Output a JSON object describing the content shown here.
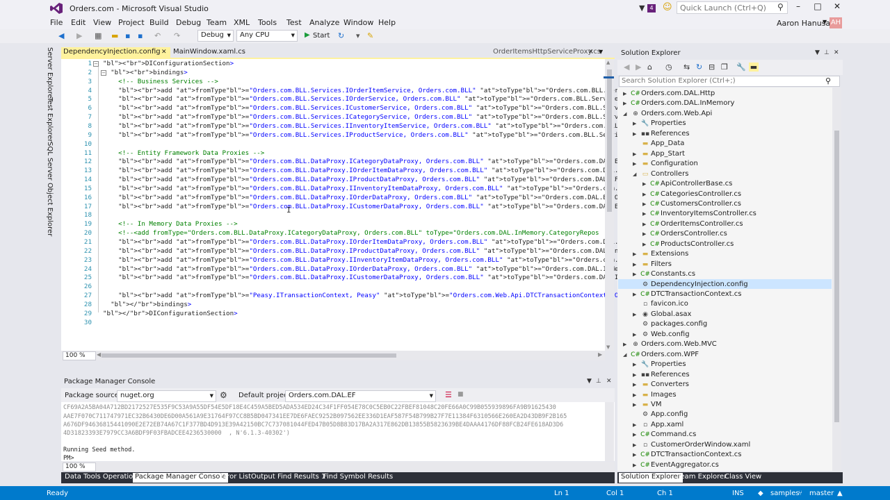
{
  "window": {
    "title": "Orders.com - Microsoft Visual Studio",
    "notification_count": "4",
    "quick_launch_placeholder": "Quick Launch (Ctrl+Q)",
    "controls": [
      "–",
      "□",
      "✕"
    ]
  },
  "menu": [
    "File",
    "Edit",
    "View",
    "Project",
    "Build",
    "Debug",
    "Team",
    "XML",
    "Tools",
    "Test",
    "Analyze",
    "Window",
    "Help"
  ],
  "user": {
    "name": "Aaron Hanusa",
    "initials": "AH"
  },
  "toolbar": {
    "config": "Debug",
    "platform": "Any CPU",
    "start_label": "Start"
  },
  "side_tabs": [
    "Server Explorer",
    "Test Explorer",
    "SQL Server Object Explorer"
  ],
  "editor": {
    "tabs": [
      "DependencyInjection.config",
      "MainWindow.xaml.cs",
      "OrderItemsHttpServiceProxy.cs"
    ],
    "zoom": "100 %",
    "line_numbers": [
      "1",
      "2",
      "3",
      "4",
      "5",
      "6",
      "7",
      "8",
      "9",
      "10",
      "11",
      "12",
      "13",
      "14",
      "15",
      "16",
      "17",
      "18",
      "19",
      "20",
      "21",
      "22",
      "23",
      "24",
      "25",
      "26",
      "27",
      "28",
      "29",
      "30"
    ],
    "lines": [
      "<DIConfigurationSection>",
      "  <bindings>",
      "    <!-- Business Services -->",
      "    <add fromType=\"Orders.com.BLL.Services.IOrderItemService, Orders.com.BLL\" toType=\"Orders.com.BLL.Services.OrderItemService, O",
      "    <add fromType=\"Orders.com.BLL.Services.IOrderService, Orders.com.BLL\" toType=\"Orders.com.BLL.Services.OrderService, Orders.co",
      "    <add fromType=\"Orders.com.BLL.Services.ICustomerService, Orders.com.BLL\" toType=\"Orders.com.BLL.Services.CustomerService, Ord",
      "    <add fromType=\"Orders.com.BLL.Services.ICategoryService, Orders.com.BLL\" toType=\"Orders.com.BLL.Services.CategoryService, Ord",
      "    <add fromType=\"Orders.com.BLL.Services.IInventoryItemService, Orders.com.BLL\" toType=\"Orders.com.BLL.Services.InventoryItemSe",
      "    <add fromType=\"Orders.com.BLL.Services.IProductService, Orders.com.BLL\" toType=\"Orders.com.BLL.Services.ProductService, Order",
      "",
      "    <!-- Entity Framework Data Proxies -->",
      "    <add fromType=\"Orders.com.BLL.DataProxy.ICategoryDataProxy, Orders.com.BLL\" toType=\"Orders.com.DAL.EF.CategoryRepository, Ord",
      "    <add fromType=\"Orders.com.BLL.DataProxy.IOrderItemDataProxy, Orders.com.BLL\" toType=\"Orders.com.DAL.EF.OrderItemRepository, O",
      "    <add fromType=\"Orders.com.BLL.DataProxy.IProductDataProxy, Orders.com.BLL\" toType=\"Orders.com.DAL.EF.ProductRepository, Order",
      "    <add fromType=\"Orders.com.BLL.DataProxy.IInventoryItemDataProxy, Orders.com.BLL\" toType=\"Orders.com.DAL.EF.InventoryItemRepos",
      "    <add fromType=\"Orders.com.BLL.DataProxy.IOrderDataProxy, Orders.com.BLL\" toType=\"Orders.com.DAL.EF.OrderRepository, Orders.co",
      "    <add fromType=\"Orders.com.BLL.DataProxy.ICustomerDataProxy, Orders.com.BLL\" toType=\"Orders.com.DAL.EF.CustomerRepository, Ord",
      "",
      "    <!-- In Memory Data Proxies -->",
      "    <!--<add fromType=\"Orders.com.BLL.DataProxy.ICategoryDataProxy, Orders.com.BLL\" toType=\"Orders.com.DAL.InMemory.CategoryRepos",
      "    <add fromType=\"Orders.com.BLL.DataProxy.IOrderItemDataProxy, Orders.com.BLL\" toType=\"Orders.com.DAL.InMemory.OrderItemReposit",
      "    <add fromType=\"Orders.com.BLL.DataProxy.IProductDataProxy, Orders.com.BLL\" toType=\"Orders.com.DAL.InMemory.ProductRepository,",
      "    <add fromType=\"Orders.com.BLL.DataProxy.IInventoryItemDataProxy, Orders.com.BLL\" toType=\"Orders.com.DAL.InMemory.InventoryIte",
      "    <add fromType=\"Orders.com.BLL.DataProxy.IOrderDataProxy, Orders.com.BLL\" toType=\"Orders.com.DAL.InMemory.OrderRepository, Ord",
      "    <add fromType=\"Orders.com.BLL.DataProxy.ICustomerDataProxy, Orders.com.BLL\" toType=\"Orders.com.DAL.InMemory.CustomerRepositor",
      "",
      "    <add fromType=\"Peasy.ITransactionContext, Peasy\" toType=\"Orders.com.Web.Api.DTCTransactionContext, Orders.com.Web.Api\" />",
      "  </bindings>",
      "</DIConfigurationSection>",
      ""
    ]
  },
  "pmc": {
    "title": "Package Manager Console",
    "source_label": "Package source:",
    "source_value": "nuget.org",
    "project_label": "Default project:",
    "project_value": "Orders.com.DAL.EF",
    "zoom": "100 %",
    "output_gray": [
      "CF69A2A5BA04A712BD2172527E535F9C53A9A55DF54E5DF18E4C459A5BED5ADA534ED24C34F1FF054E78C0C5EB0C22FBEF81048C20FE66A0C99B055939896FA9B91625430",
      "AAE7F070C711747971EC32B6430DE6D00A561A9E31764F97CC8B5BD047341EE7DE6FAEC9252B097562EE336D1EAF587F54B799B27F7E11384F6310566E260EA2D43DB9F2B165",
      "A676DF94636815441090E2E72EB74A67C1F377BD4D913E39A42150BC7C737081044FED47B05D8B83D17BA2A317E862DB13855B5823639BE4DAAA4176DF88FCB24FE618AD3D6",
      "4D31823393E7979CC3A6BDF9F03FBADCEE4236530000  , N'6.1.3-40302')"
    ],
    "output": [
      "Running Seed method.",
      "PM>"
    ]
  },
  "bottom_tabs": [
    "Data Tools Operations",
    "Package Manager Console",
    "Error List",
    "Output",
    "Find Results 1",
    "Find Symbol Results"
  ],
  "solution_explorer": {
    "title": "Solution Explorer",
    "search_placeholder": "Search Solution Explorer (Ctrl+;)",
    "items": [
      {
        "label": "Orders.com.DAL.Http",
        "level": 0,
        "exp": "▶",
        "icon": "C#"
      },
      {
        "label": "Orders.com.DAL.InMemory",
        "level": 0,
        "exp": "▶",
        "icon": "C#"
      },
      {
        "label": "Orders.com.Web.Api",
        "level": 0,
        "exp": "◢",
        "icon": "⊕"
      },
      {
        "label": "Properties",
        "level": 1,
        "exp": "▶",
        "icon": "🔧"
      },
      {
        "label": "References",
        "level": 1,
        "exp": "▶",
        "icon": "▪▪"
      },
      {
        "label": "App_Data",
        "level": 1,
        "exp": "",
        "icon": "▬"
      },
      {
        "label": "App_Start",
        "level": 1,
        "exp": "▶",
        "icon": "▬"
      },
      {
        "label": "Configuration",
        "level": 1,
        "exp": "▶",
        "icon": "▬"
      },
      {
        "label": "Controllers",
        "level": 1,
        "exp": "◢",
        "icon": "▭"
      },
      {
        "label": "ApiControllerBase.cs",
        "level": 2,
        "exp": "▶",
        "icon": "C#"
      },
      {
        "label": "CategoriesController.cs",
        "level": 2,
        "exp": "▶",
        "icon": "C#"
      },
      {
        "label": "CustomersController.cs",
        "level": 2,
        "exp": "▶",
        "icon": "C#"
      },
      {
        "label": "InventoryItemsController.cs",
        "level": 2,
        "exp": "▶",
        "icon": "C#"
      },
      {
        "label": "OrderItemsController.cs",
        "level": 2,
        "exp": "▶",
        "icon": "C#"
      },
      {
        "label": "OrdersController.cs",
        "level": 2,
        "exp": "▶",
        "icon": "C#"
      },
      {
        "label": "ProductsController.cs",
        "level": 2,
        "exp": "▶",
        "icon": "C#"
      },
      {
        "label": "Extensions",
        "level": 1,
        "exp": "▶",
        "icon": "▬"
      },
      {
        "label": "Filters",
        "level": 1,
        "exp": "▶",
        "icon": "▬"
      },
      {
        "label": "Constants.cs",
        "level": 1,
        "exp": "▶",
        "icon": "C#"
      },
      {
        "label": "DependencyInjection.config",
        "level": 1,
        "exp": "",
        "icon": "⚙"
      },
      {
        "label": "DTCTransactionContext.cs",
        "level": 1,
        "exp": "▶",
        "icon": "C#"
      },
      {
        "label": "favicon.ico",
        "level": 1,
        "exp": "",
        "icon": "▫"
      },
      {
        "label": "Global.asax",
        "level": 1,
        "exp": "▶",
        "icon": "◉"
      },
      {
        "label": "packages.config",
        "level": 1,
        "exp": "",
        "icon": "⚙"
      },
      {
        "label": "Web.config",
        "level": 1,
        "exp": "▶",
        "icon": "⚙"
      },
      {
        "label": "Orders.com.Web.MVC",
        "level": 0,
        "exp": "▶",
        "icon": "⊕"
      },
      {
        "label": "Orders.com.WPF",
        "level": 0,
        "exp": "◢",
        "icon": "C#"
      },
      {
        "label": "Properties",
        "level": 1,
        "exp": "▶",
        "icon": "🔧"
      },
      {
        "label": "References",
        "level": 1,
        "exp": "▶",
        "icon": "▪▪"
      },
      {
        "label": "Converters",
        "level": 1,
        "exp": "▶",
        "icon": "▬"
      },
      {
        "label": "Images",
        "level": 1,
        "exp": "▶",
        "icon": "▬"
      },
      {
        "label": "VM",
        "level": 1,
        "exp": "▶",
        "icon": "▬"
      },
      {
        "label": "App.config",
        "level": 1,
        "exp": "",
        "icon": "⚙"
      },
      {
        "label": "App.xaml",
        "level": 1,
        "exp": "▶",
        "icon": "▫"
      },
      {
        "label": "Command.cs",
        "level": 1,
        "exp": "▶",
        "icon": "C#"
      },
      {
        "label": "CustomerOrderWindow.xaml",
        "level": 1,
        "exp": "▶",
        "icon": "▫"
      },
      {
        "label": "DTCTransactionContext.cs",
        "level": 1,
        "exp": "▶",
        "icon": "C#"
      },
      {
        "label": "EventAggregator.cs",
        "level": 1,
        "exp": "▶",
        "icon": "C#"
      }
    ],
    "tabs": [
      "Solution Explorer",
      "Team Explorer",
      "Class View"
    ]
  },
  "status": {
    "state": "Ready",
    "line": "Ln 1",
    "col": "Col 1",
    "ch": "Ch 1",
    "mode": "INS",
    "repo": "samples",
    "branch": "master"
  },
  "colors": {
    "accent": "#007acc",
    "active_tab": "#fff29d",
    "vs_purple": "#68217a"
  }
}
